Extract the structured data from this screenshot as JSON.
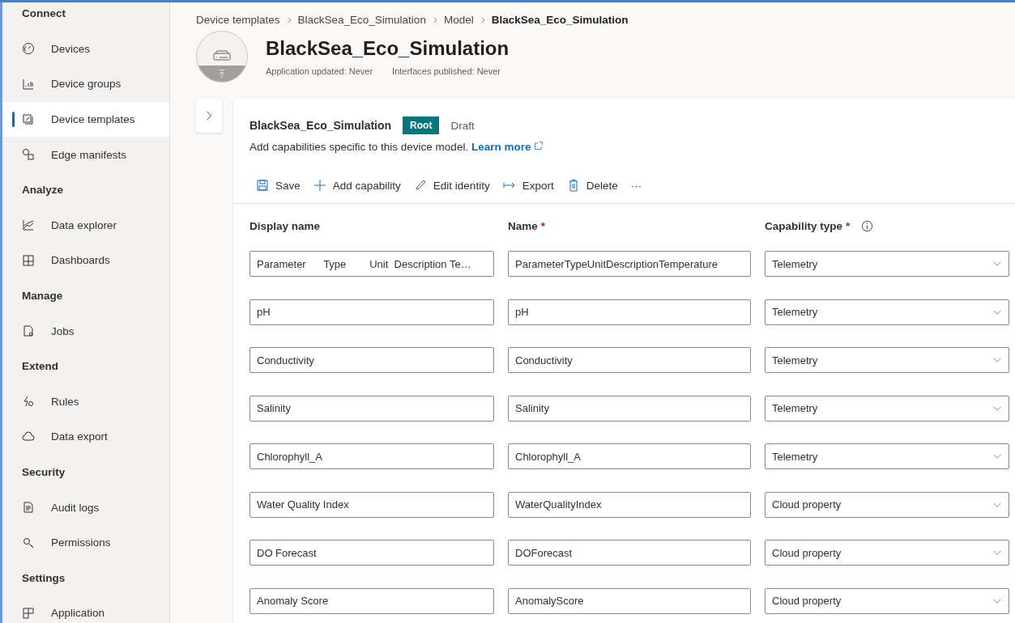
{
  "sidebar": {
    "sections": [
      {
        "heading": "Connect",
        "items": [
          {
            "label": "Devices",
            "selected": false
          },
          {
            "label": "Device groups",
            "selected": false
          },
          {
            "label": "Device templates",
            "selected": true
          },
          {
            "label": "Edge manifests",
            "selected": false
          }
        ]
      },
      {
        "heading": "Analyze",
        "items": [
          {
            "label": "Data explorer",
            "selected": false
          },
          {
            "label": "Dashboards",
            "selected": false
          }
        ]
      },
      {
        "heading": "Manage",
        "items": [
          {
            "label": "Jobs",
            "selected": false
          }
        ]
      },
      {
        "heading": "Extend",
        "items": [
          {
            "label": "Rules",
            "selected": false
          },
          {
            "label": "Data export",
            "selected": false
          }
        ]
      },
      {
        "heading": "Security",
        "items": [
          {
            "label": "Audit logs",
            "selected": false
          },
          {
            "label": "Permissions",
            "selected": false
          }
        ]
      },
      {
        "heading": "Settings",
        "items": [
          {
            "label": "Application",
            "selected": false
          }
        ]
      }
    ]
  },
  "breadcrumb": [
    "Device templates",
    "BlackSea_Eco_Simulation",
    "Model",
    "BlackSea_Eco_Simulation"
  ],
  "header": {
    "title": "BlackSea_Eco_Simulation",
    "meta": [
      "Application updated: Never",
      "Interfaces published: Never"
    ]
  },
  "model": {
    "name": "BlackSea_Eco_Simulation",
    "badge": "Root",
    "status": "Draft",
    "description": "Add capabilities specific to this device model.",
    "link": "Learn more"
  },
  "toolbar": [
    "Save",
    "Add capability",
    "Edit identity",
    "Export",
    "Delete",
    "···"
  ],
  "table": {
    "columns": [
      {
        "label": "Display name",
        "info": false
      },
      {
        "label": "Name",
        "required_mark": "*",
        "info": false
      },
      {
        "label": "Capability type",
        "required_mark": "*",
        "info": true
      }
    ],
    "rows": [
      {
        "display_name": "Parameter      Type        Unit  Description Te…",
        "name": "ParameterTypeUnitDescriptionTemperature",
        "type": "Telemetry"
      },
      {
        "display_name": "pH",
        "name": "pH",
        "type": "Telemetry"
      },
      {
        "display_name": "Conductivity",
        "name": "Conductivity",
        "type": "Telemetry"
      },
      {
        "display_name": "Salinity",
        "name": "Salinity",
        "type": "Telemetry"
      },
      {
        "display_name": "Chlorophyll_A",
        "name": "Chlorophyll_A",
        "type": "Telemetry"
      },
      {
        "display_name": "Water Quality Index",
        "name": "WaterQualityIndex",
        "type": "Cloud property"
      },
      {
        "display_name": "DO Forecast",
        "name": "DOForecast",
        "type": "Cloud property"
      },
      {
        "display_name": "Anomaly Score",
        "name": "AnomalyScore",
        "type": "Cloud property"
      }
    ]
  }
}
